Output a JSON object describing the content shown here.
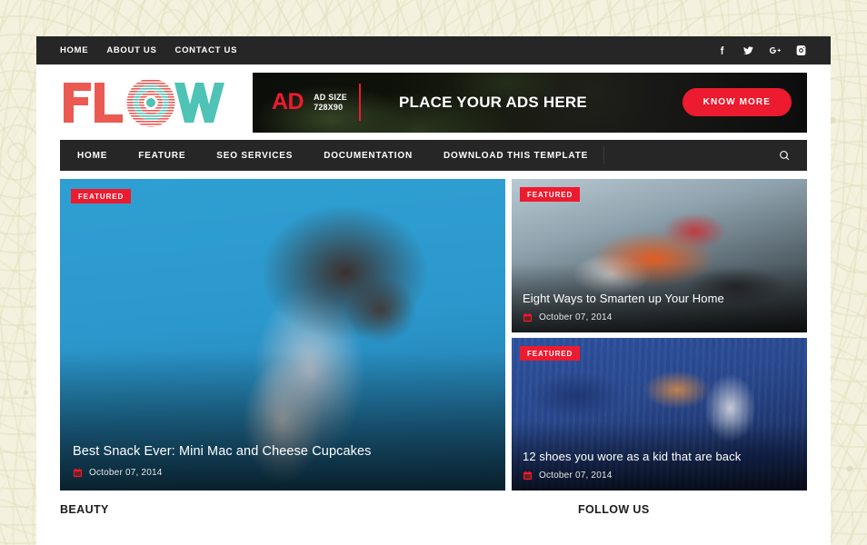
{
  "topbar": {
    "nav": [
      {
        "label": "HOME",
        "name": "topnav-home"
      },
      {
        "label": "ABOUT US",
        "name": "topnav-about-us"
      },
      {
        "label": "CONTACT US",
        "name": "topnav-contact-us"
      }
    ],
    "socials": [
      {
        "icon": "facebook-icon"
      },
      {
        "icon": "twitter-icon"
      },
      {
        "icon": "google-plus-icon"
      },
      {
        "icon": "instagram-icon"
      }
    ]
  },
  "brand": {
    "name": "FLOW",
    "red": "#ea5a52",
    "teal": "#4ec3b6"
  },
  "ad": {
    "label": "AD",
    "size_line1": "AD SIZE",
    "size_line2": "728X90",
    "headline": "PLACE YOUR ADS HERE",
    "button": "KNOW MORE",
    "accent": "#ed1b2f"
  },
  "mainnav": {
    "items": [
      {
        "label": "HOME",
        "name": "mainnav-home"
      },
      {
        "label": "FEATURE",
        "name": "mainnav-feature"
      },
      {
        "label": "SEO SERVICES",
        "name": "mainnav-seo-services"
      },
      {
        "label": "DOCUMENTATION",
        "name": "mainnav-documentation"
      },
      {
        "label": "DOWNLOAD THIS TEMPLATE",
        "name": "mainnav-download-this-template"
      }
    ],
    "search_icon": "search-icon"
  },
  "hero": {
    "featured_badge": "FEATURED",
    "main": {
      "title": "Best Snack Ever: Mini Mac and Cheese Cupcakes",
      "date": "October 07, 2014"
    },
    "side": [
      {
        "title": "Eight Ways to Smarten up Your Home",
        "date": "October 07, 2014"
      },
      {
        "title": "12 shoes you wore as a kid that are back",
        "date": "October 07, 2014"
      }
    ]
  },
  "bottom": {
    "left_heading": "BEAUTY",
    "right_heading": "FOLLOW US"
  }
}
